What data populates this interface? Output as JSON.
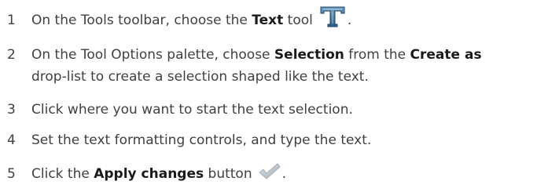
{
  "steps": [
    {
      "number": "1",
      "pre": "On the Tools toolbar, choose the ",
      "bold1": "Text",
      "post": " tool",
      "tail": ".",
      "icon": "text-tool-icon"
    },
    {
      "number": "2",
      "pre": "On the Tool Options palette, choose ",
      "bold1": "Selection",
      "mid": " from the ",
      "bold2": "Create as",
      "line2": "drop-list to create a selection shaped like the text."
    },
    {
      "number": "3",
      "text": "Click where you want to start the text selection."
    },
    {
      "number": "4",
      "text": "Set the text formatting controls, and type the text."
    },
    {
      "number": "5",
      "pre": "Click the ",
      "bold1": "Apply changes",
      "post": " button",
      "tail": ".",
      "icon": "checkmark-icon"
    }
  ],
  "colors": {
    "body_text": "#404040",
    "bold_text": "#1a1a1a",
    "text_icon": "#2f5f8a",
    "check_icon": "#b8c0c8"
  }
}
